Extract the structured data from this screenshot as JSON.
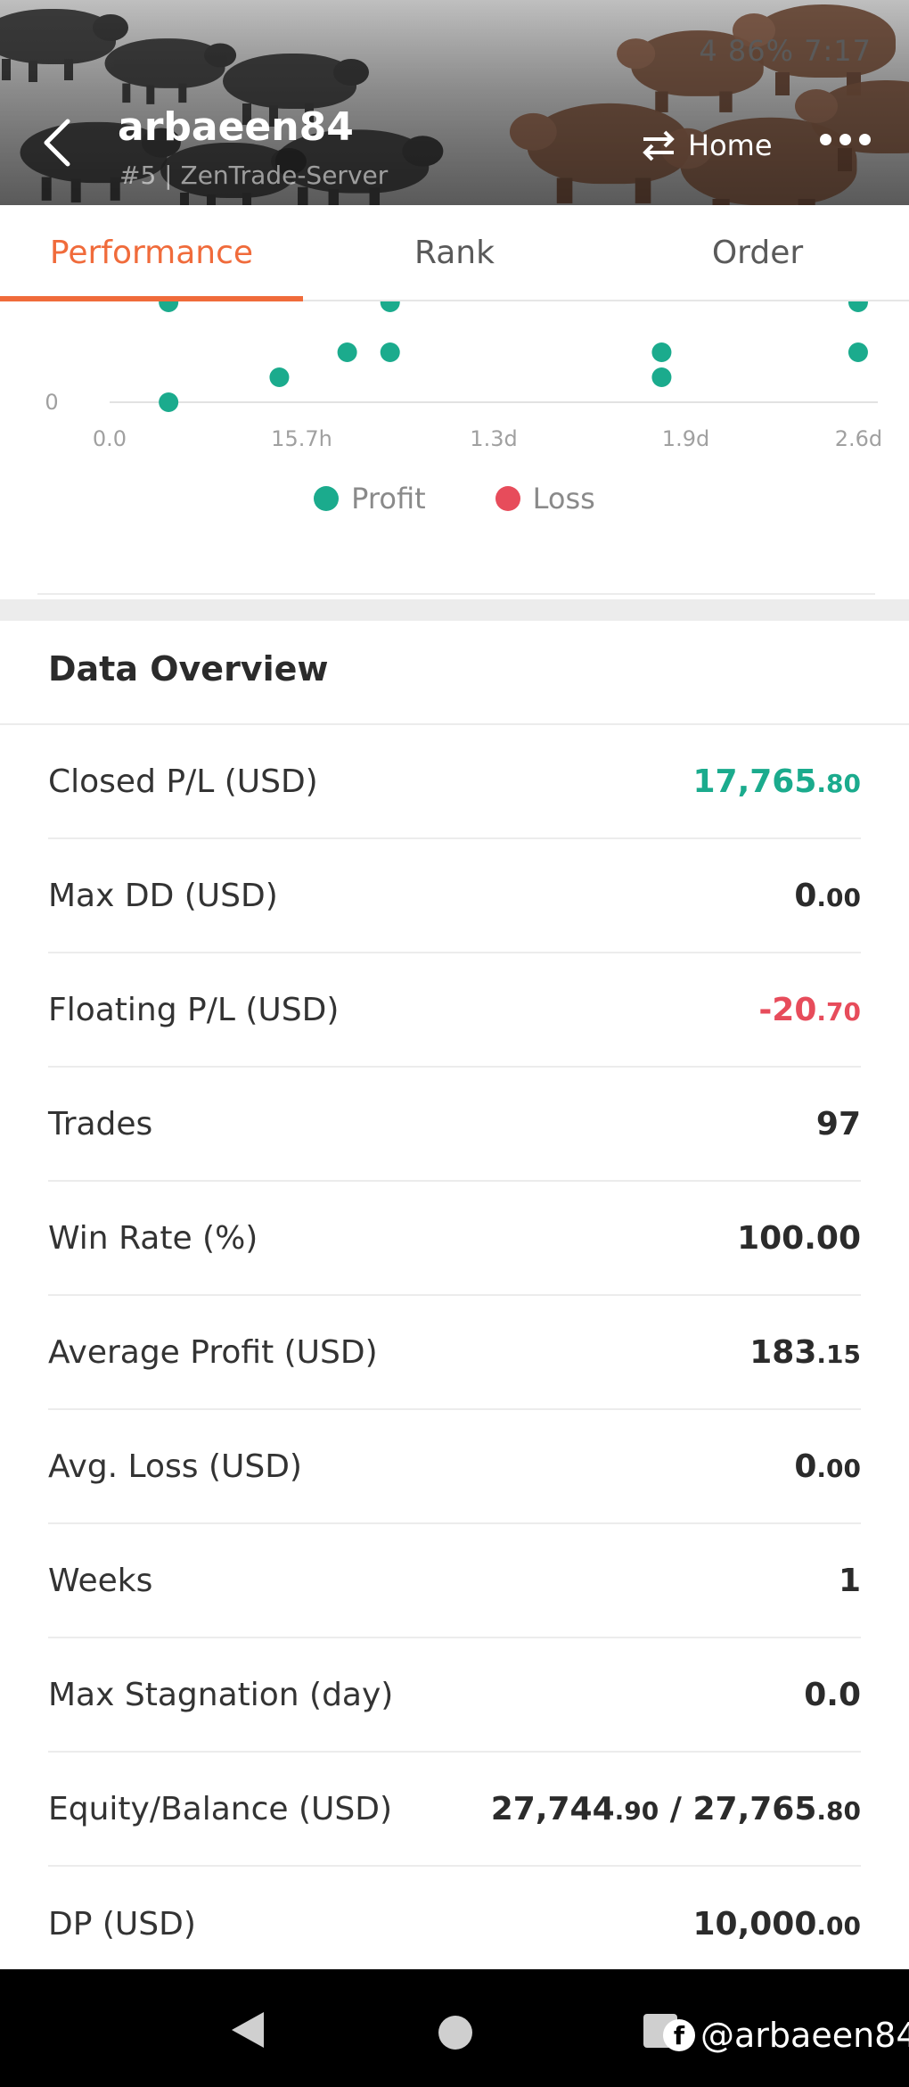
{
  "status_bar": {
    "text": "4  86% 7:17"
  },
  "header": {
    "username": "arbaeen84",
    "server": "#5 | ZenTrade-Server",
    "home_label": "Home"
  },
  "tabs": [
    {
      "label": "Performance",
      "active": true
    },
    {
      "label": "Rank",
      "active": false
    },
    {
      "label": "Order",
      "active": false
    }
  ],
  "chart_data": {
    "type": "scatter",
    "x_tick_labels": [
      "0.0",
      "15.7h",
      "1.3d",
      "1.9d",
      "2.6d"
    ],
    "y_tick_labels": [
      "0"
    ],
    "series": [
      {
        "name": "Profit",
        "color": "#1bab8d",
        "points": [
          {
            "x": 0.33,
            "y": 0
          },
          {
            "x": 0.95,
            "y": 1
          },
          {
            "x": 1.33,
            "y": 2
          },
          {
            "x": 1.57,
            "y": 2
          },
          {
            "x": 3.09,
            "y": 2
          },
          {
            "x": 3.09,
            "y": 1
          },
          {
            "x": 4.19,
            "y": 2
          },
          {
            "x": 0.33,
            "y": 4
          },
          {
            "x": 1.57,
            "y": 4
          },
          {
            "x": 4.19,
            "y": 4
          }
        ]
      },
      {
        "name": "Loss",
        "color": "#e74c5b",
        "points": []
      }
    ]
  },
  "overview": {
    "title": "Data Overview",
    "rows": [
      {
        "label": "Closed P/L (USD)",
        "int": "17,765",
        "dec": ".80",
        "tone": "pos"
      },
      {
        "label": "Max DD (USD)",
        "int": "0",
        "dec": ".00",
        "tone": ""
      },
      {
        "label": "Floating P/L (USD)",
        "int": "-20",
        "dec": ".70",
        "tone": "neg"
      },
      {
        "label": "Trades",
        "int": "97",
        "dec": "",
        "tone": ""
      },
      {
        "label": "Win Rate (%)",
        "int": "100.00",
        "dec": "",
        "tone": ""
      },
      {
        "label": "Average Profit (USD)",
        "int": "183",
        "dec": ".15",
        "tone": ""
      },
      {
        "label": "Avg. Loss (USD)",
        "int": "0",
        "dec": ".00",
        "tone": ""
      },
      {
        "label": "Weeks",
        "int": "1",
        "dec": "",
        "tone": ""
      },
      {
        "label": "Max Stagnation (day)",
        "int": "0.0",
        "dec": "",
        "tone": ""
      },
      {
        "label": "Equity/Balance (USD)",
        "int": "27,744",
        "dec": ".90",
        "int2": " / 27,765",
        "dec2": ".80",
        "tone": ""
      },
      {
        "label": "DP (USD)",
        "int": "10,000",
        "dec": ".00",
        "tone": ""
      }
    ]
  },
  "watermark": {
    "text": "@arbaeen84"
  }
}
